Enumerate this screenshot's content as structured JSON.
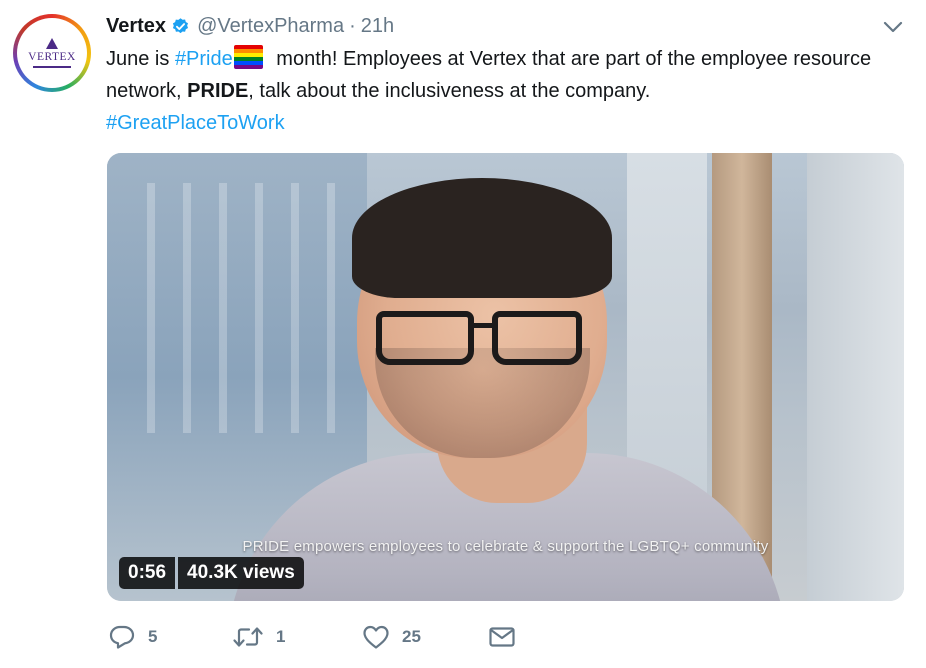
{
  "tweet": {
    "avatar_text": "VERTEX",
    "name": "Vertex",
    "handle": "@VertexPharma",
    "separator": "·",
    "time": "21h",
    "text": {
      "seg1": "June is ",
      "hashtag_pride": "#Pride",
      "seg2": " month! Employees at Vertex that are part of the employee resource network, ",
      "bold": "PRIDE",
      "seg3": ", talk about the inclusiveness at the company.",
      "hashtag_work": "#GreatPlaceToWork"
    }
  },
  "video": {
    "caption": "PRIDE empowers employees to celebrate & support the LGBTQ+ community",
    "duration": "0:56",
    "views": "40.3K views"
  },
  "actions": {
    "reply_count": "5",
    "retweet_count": "1",
    "like_count": "25"
  },
  "colors": {
    "link": "#1da1f2",
    "secondary": "#657786",
    "text": "#14171a",
    "brand_purple": "#4b2a86"
  }
}
